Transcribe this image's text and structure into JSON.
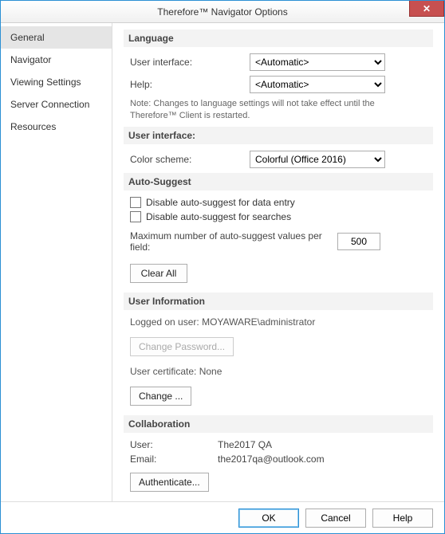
{
  "window": {
    "title": "Therefore™ Navigator Options",
    "close_glyph": "✕"
  },
  "sidebar": {
    "items": [
      {
        "label": "General",
        "selected": true
      },
      {
        "label": "Navigator",
        "selected": false
      },
      {
        "label": "Viewing Settings",
        "selected": false
      },
      {
        "label": "Server Connection",
        "selected": false
      },
      {
        "label": "Resources",
        "selected": false
      }
    ]
  },
  "sections": {
    "language": {
      "header": "Language",
      "ui_label": "User interface:",
      "ui_value": "<Automatic>",
      "help_label": "Help:",
      "help_value": "<Automatic>",
      "note": "Note: Changes to language settings will not take effect until the Therefore™ Client is restarted."
    },
    "ui": {
      "header": "User interface:",
      "color_label": "Color scheme:",
      "color_value": "Colorful (Office 2016)"
    },
    "auto": {
      "header": "Auto-Suggest",
      "chk_entry": "Disable auto-suggest for data entry",
      "chk_search": "Disable auto-suggest for searches",
      "max_label": "Maximum number of auto-suggest values per field:",
      "max_value": "500",
      "clear_btn": "Clear All"
    },
    "userinfo": {
      "header": "User Information",
      "logged": "Logged on user: MOYAWARE\\administrator",
      "change_pw_btn": "Change Password...",
      "cert_line": "User certificate: None",
      "change_btn": "Change ..."
    },
    "collab": {
      "header": "Collaboration",
      "user_label": "User:",
      "user_value": "The2017 QA",
      "email_label": "Email:",
      "email_value": "the2017qa@outlook.com",
      "auth_btn": "Authenticate..."
    }
  },
  "footer": {
    "ok": "OK",
    "cancel": "Cancel",
    "help": "Help"
  }
}
